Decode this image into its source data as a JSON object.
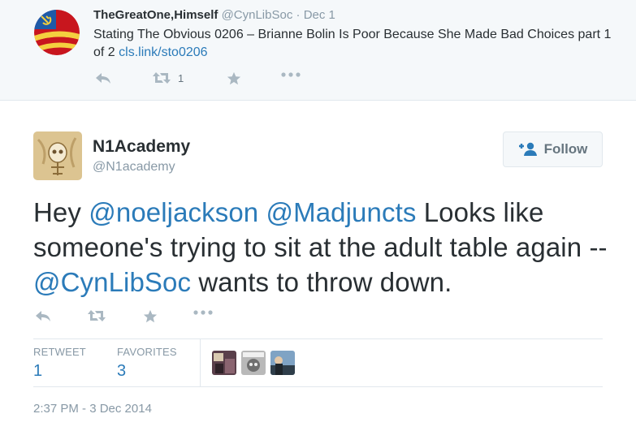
{
  "parent_tweet": {
    "fullname": "TheGreatOne,Himself",
    "username": "@CynLibSoc",
    "separator": "·",
    "time": "Dec 1",
    "text": "Stating The Obvious 0206 – Brianne Bolin Is Poor Because She Made Bad Choices part 1 of 2",
    "link": "cls.link/sto0206",
    "avatar_icon": "hammer-sickle-flag-icon",
    "retweet_count": "1",
    "actions": [
      "reply-icon",
      "retweet-icon",
      "favorite-icon",
      "more-icon"
    ]
  },
  "tweet": {
    "fullname": "N1Academy",
    "username": "@N1academy",
    "avatar_icon": "skull-sketch-avatar",
    "follow_label": "Follow",
    "text_parts": {
      "t1": "Hey ",
      "m1": "@noeljackson",
      "t2": " ",
      "m2": "@Madjuncts",
      "t3": " Looks like someone's trying to sit at the adult table again -- ",
      "m3": "@CynLibSoc",
      "t4": " wants to throw down."
    },
    "stats": {
      "retweet_label": "RETWEET",
      "retweet_value": "1",
      "favorites_label": "FAVORITES",
      "favorites_value": "3"
    },
    "timestamp": "2:37 PM - 3 Dec 2014",
    "actions": [
      "reply-icon",
      "retweet-icon",
      "favorite-icon",
      "more-icon"
    ]
  },
  "colors": {
    "link": "#2b7bb9",
    "muted": "#8899a6",
    "text": "#292f33",
    "parent_bg": "#f5f8fa",
    "border": "#e1e8ed"
  }
}
